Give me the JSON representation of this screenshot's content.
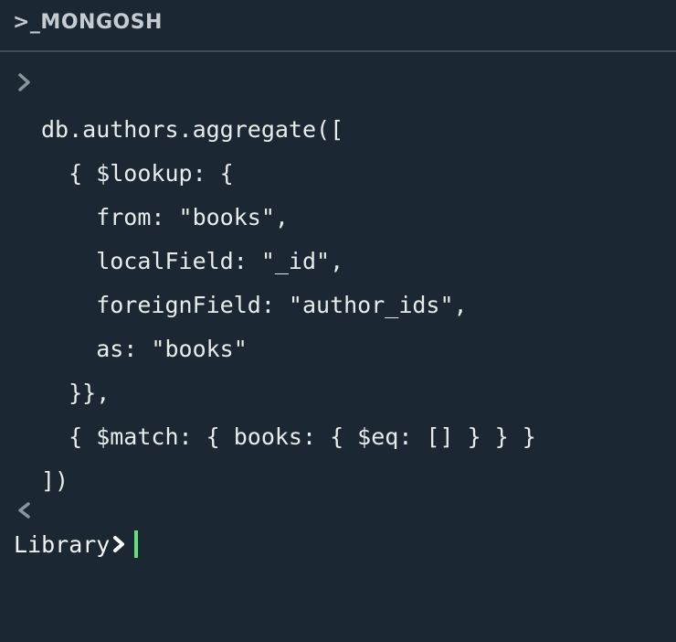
{
  "app": {
    "title": ">_MONGOSH"
  },
  "input": {
    "prompt_icon": "chevron-right-icon",
    "code_lines": [
      "db.authors.aggregate([",
      "  { $lookup: {",
      "    from: \"books\",",
      "    localField: \"_id\",",
      "    foreignField: \"author_ids\",",
      "    as: \"books\"",
      "  }},",
      "  { $match: { books: { $eq: [] } } }",
      "])"
    ]
  },
  "output": {
    "icon": "chevron-left-icon"
  },
  "prompt": {
    "db_name": "Library",
    "icon": "chevron-right-icon"
  },
  "colors": {
    "background": "#1b2733",
    "header_text": "#c5cbd0",
    "divider": "#3e4b57",
    "code_text": "#e8edeb",
    "icon_gray": "#8a949c",
    "cursor": "#5fe07a"
  }
}
